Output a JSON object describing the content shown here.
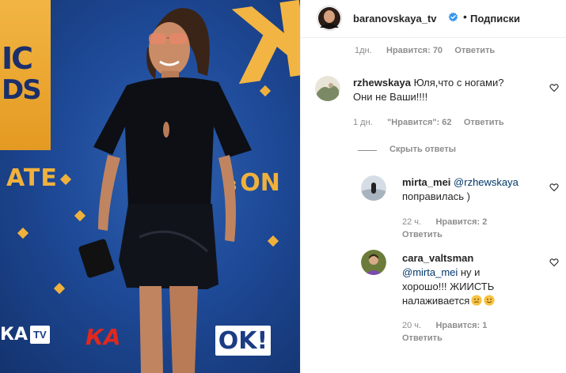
{
  "photo": {
    "banner_top": "IC",
    "banner_mid": "DS",
    "banner_ate": "ATE",
    "logo_letter": "Ж",
    "v_on_small": "в",
    "v_on": "ON",
    "logo_tv_k": "КА",
    "logo_tv": "TV",
    "logo_ka": "КА",
    "logo_ok": "OK!"
  },
  "header": {
    "username": "baranovskaya_tv",
    "dot": "•",
    "follow_label": "Подписки"
  },
  "cut_row": {
    "time": "1дн.",
    "likes": "Нравится: 70",
    "reply": "Ответить"
  },
  "comments": [
    {
      "username": "rzhewskaya",
      "text_line1": "Юля,что с ногами?",
      "text_line2": "Они не Ваши!!!!",
      "time": "1 дн.",
      "likes": "\"Нравится\": 62",
      "reply": "Ответить"
    }
  ],
  "hide_replies": "Скрыть ответы",
  "replies": [
    {
      "username": "mirta_mei",
      "mention": "@rzhewskaya",
      "text": "поправилась )",
      "time": "22 ч.",
      "likes": "Нравится: 2",
      "reply": "Ответить"
    },
    {
      "username": "cara_valtsman",
      "mention": "@mirta_mei",
      "text_after_mention": " ну и",
      "text_line2": "хорошо!!! ЖИИСТЬ",
      "text_line3": "налаживается",
      "time": "20 ч.",
      "likes": "Нравится: 1",
      "reply": "Ответить"
    }
  ],
  "icons": {
    "verified": "verified-badge-icon",
    "heart": "heart-outline-icon",
    "emoji1": "confused-face-emoji",
    "emoji2": "smiling-face-emoji"
  },
  "colors": {
    "verified_blue": "#3897f0",
    "mention_blue": "#00376b",
    "muted_gray": "#8e8e8e",
    "text": "#262626",
    "backdrop_blue": "#1e4a98",
    "accent_gold": "#f0b13c"
  }
}
